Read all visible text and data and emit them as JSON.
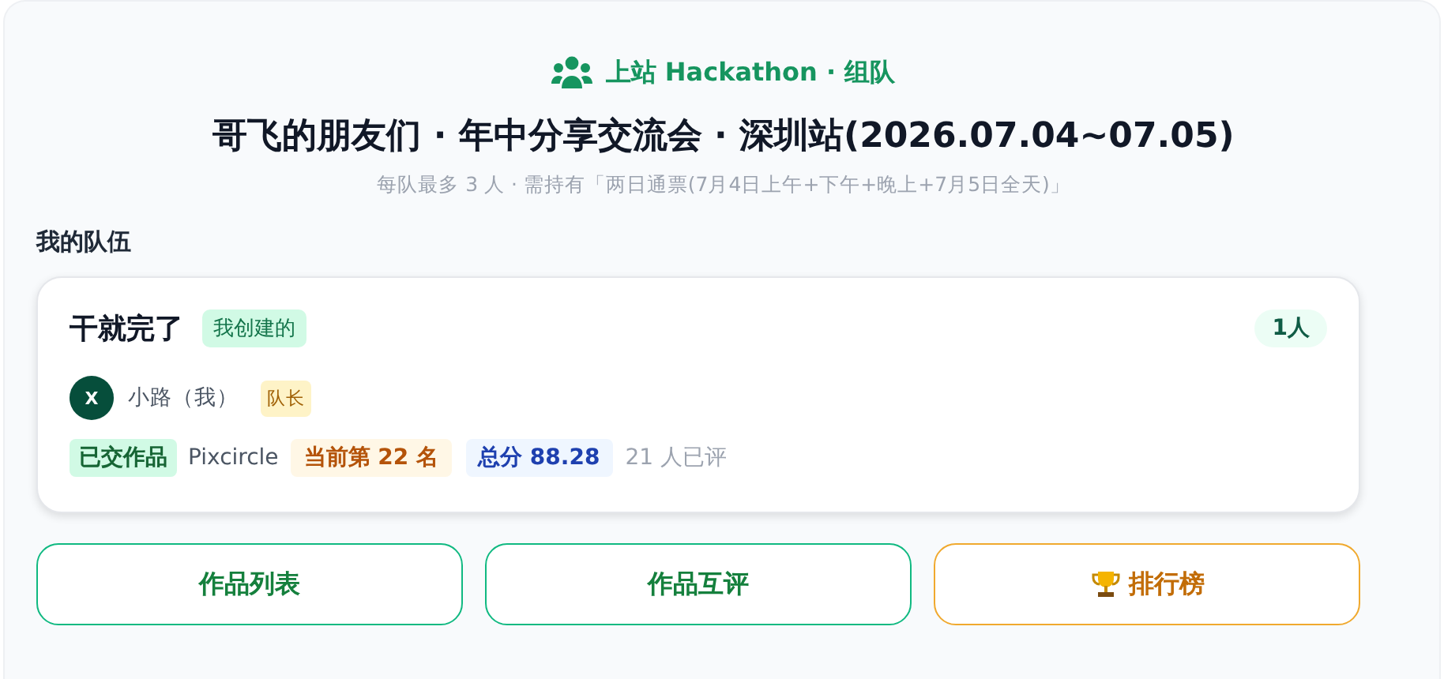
{
  "header": {
    "label": "上站 Hackathon · 组队",
    "title": "哥飞的朋友们 · 年中分享交流会 · 深圳站(2026.07.04~07.05)",
    "subtitle": "每队最多 3 人 · 需持有「两日通票(7月4日上午+下午+晚上+7月5日全天)」"
  },
  "section_title": "我的队伍",
  "team": {
    "name": "干就完了",
    "tag": "我创建的",
    "count": "1人",
    "members": [
      {
        "initial": "X",
        "name": "小路（我）",
        "role": "队长"
      }
    ],
    "submission": {
      "status": "已交作品",
      "project": "Pixcircle",
      "rank": "当前第 22 名",
      "score": "总分 88.28",
      "reviews": "21 人已评"
    }
  },
  "buttons": [
    {
      "label": "作品列表",
      "kind": "primary"
    },
    {
      "label": "作品互评",
      "kind": "primary"
    },
    {
      "label": "排行榜",
      "kind": "trophy"
    }
  ]
}
